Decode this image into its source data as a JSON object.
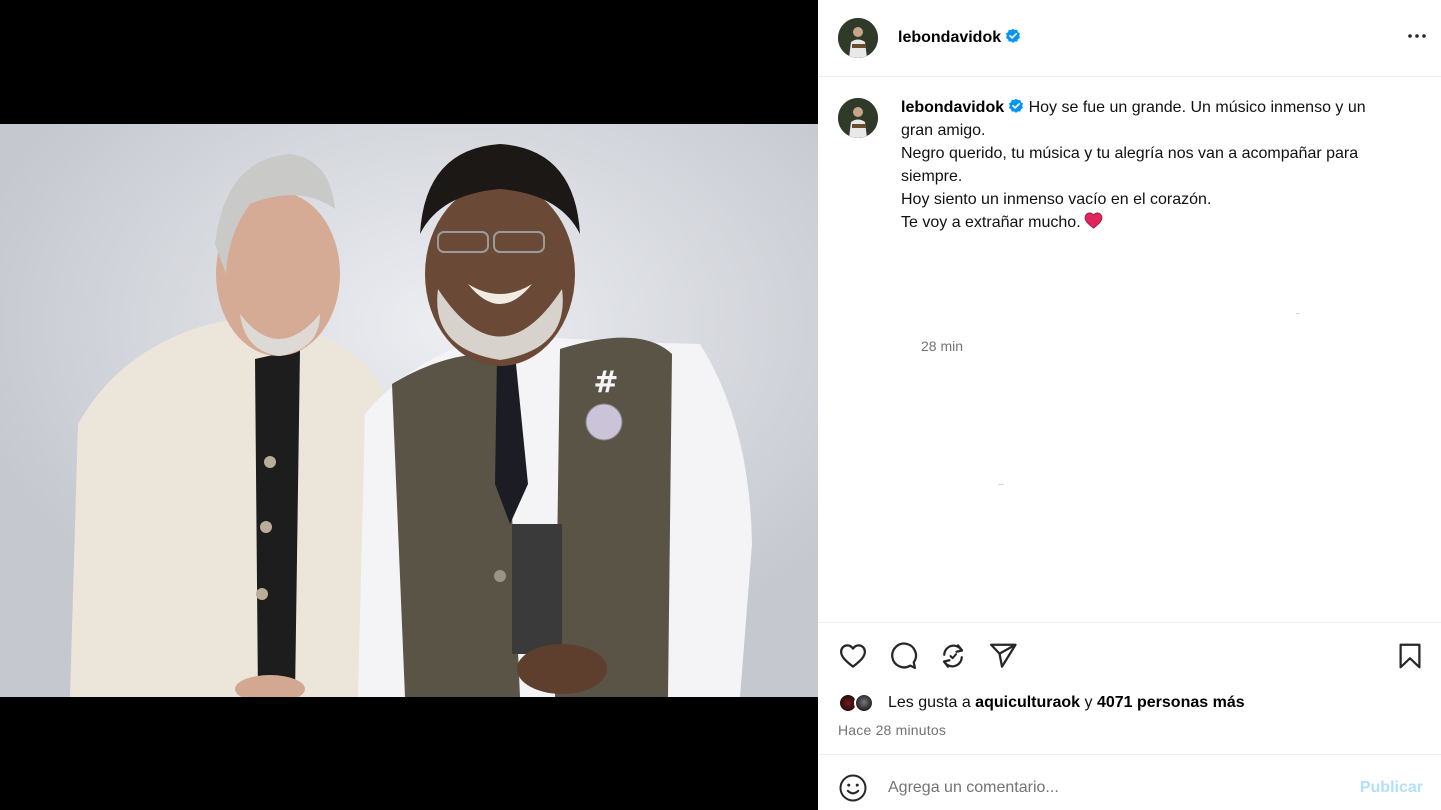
{
  "post": {
    "username": "lebondavidok",
    "verified": true,
    "more_icon": "more-horizontal-icon"
  },
  "caption": {
    "username": "lebondavidok",
    "lines": [
      "Hoy se fue un grande. Un músico inmenso y un",
      "gran amigo.",
      "Negro querido, tu música y tu alegría nos van a acompañar para",
      "siempre.",
      "Hoy siento un inmenso vacío en el corazón.",
      "Te voy a extrañar mucho."
    ],
    "emoji": "red-heart",
    "time": "28 min"
  },
  "actions": {
    "like_icon": "heart-icon",
    "comment_icon": "comment-icon",
    "repost_icon": "repost-icon",
    "share_icon": "send-icon",
    "save_icon": "bookmark-icon"
  },
  "likes": {
    "prefix": "Les gusta a ",
    "first_liker": "aquiculturaok",
    "connector": " y ",
    "others": "4071 personas más"
  },
  "timestamp": "Hace 28 minutos",
  "comment": {
    "placeholder": "Agrega un comentario...",
    "value": "",
    "publish_label": "Publicar"
  },
  "colors": {
    "verified": "#0095f6",
    "publish_disabled": "#b2dffc",
    "heart": "#e0245e",
    "secondary_text": "#737373"
  }
}
